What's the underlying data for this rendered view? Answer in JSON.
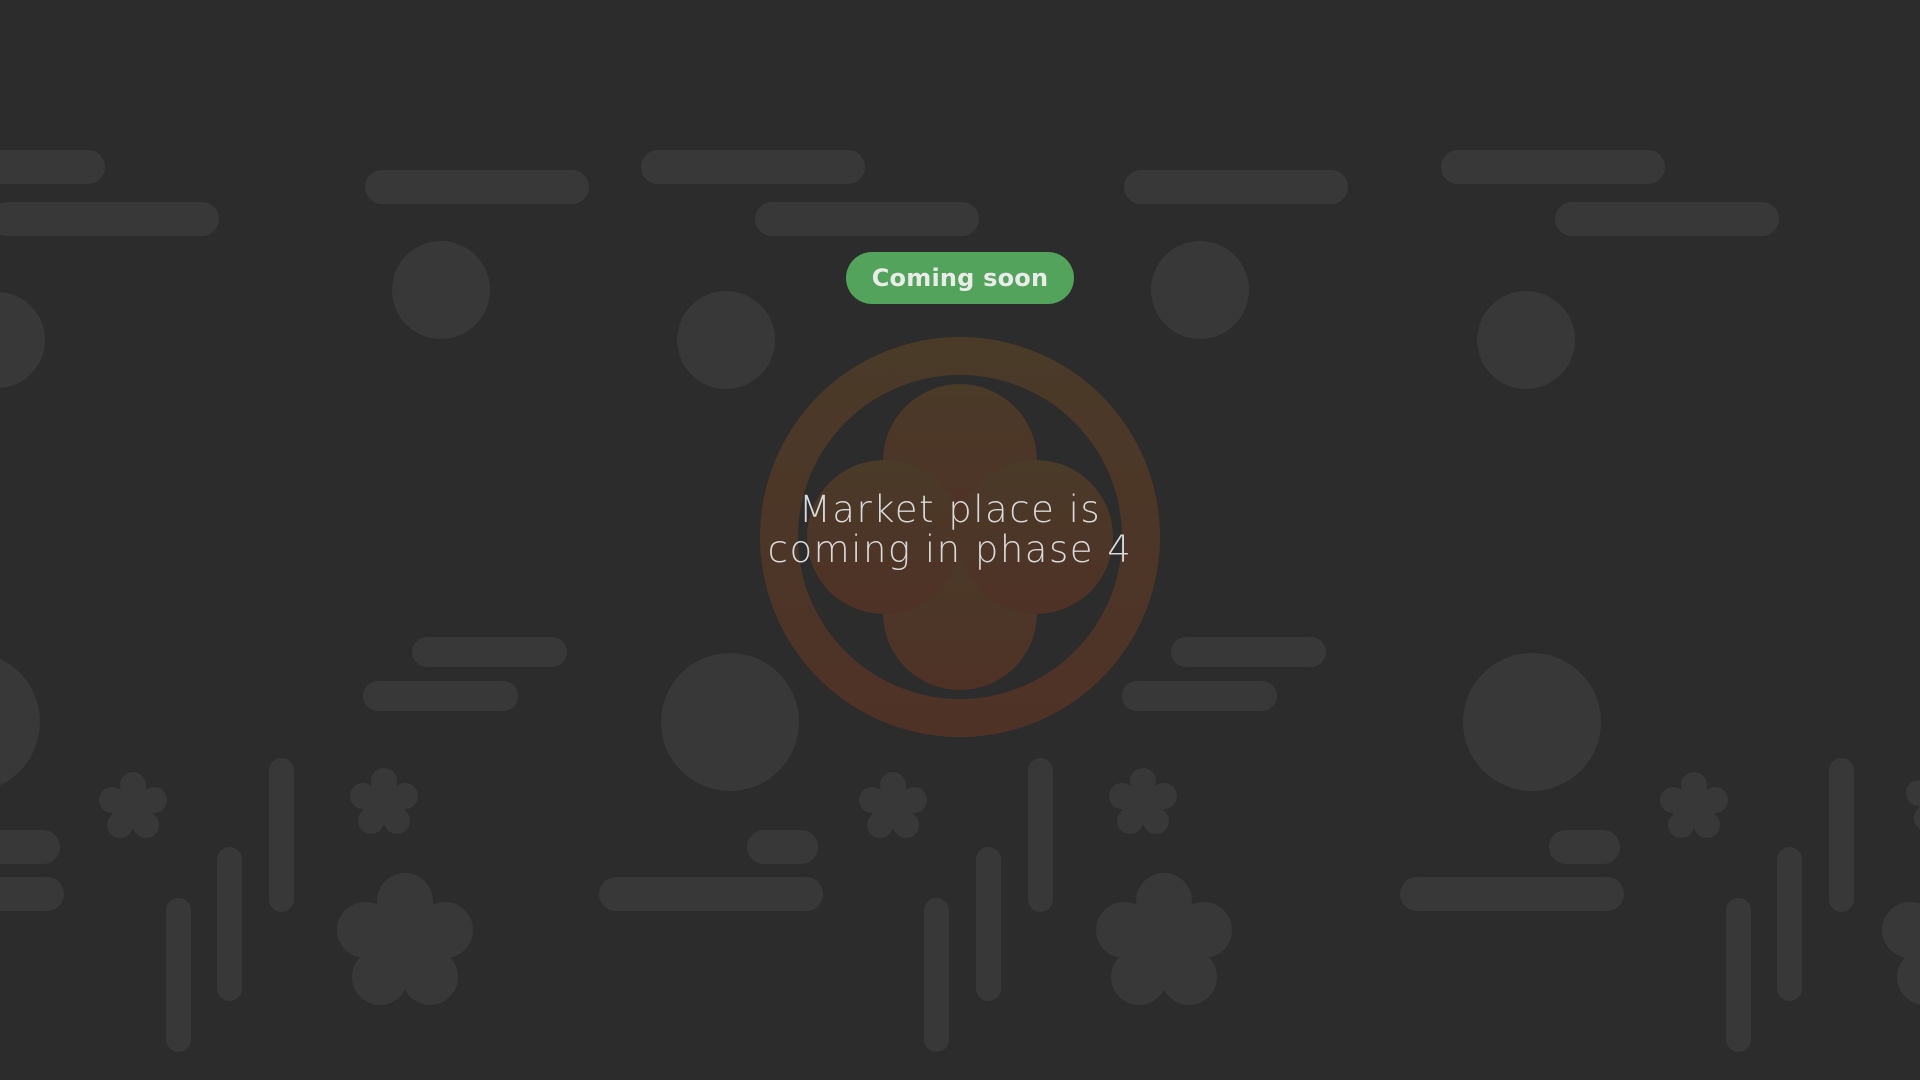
{
  "badge": {
    "label": "Coming soon",
    "color": "#54a35c"
  },
  "message": {
    "line1": "Market place is",
    "line2": "coming in phase 4"
  },
  "emblem": {
    "icon": "four-petal-crest-icon",
    "color_top": "#4a3a28",
    "color_bottom": "#4f3226"
  },
  "background": {
    "color": "#2c2c2c",
    "pattern_color": "#383838"
  }
}
